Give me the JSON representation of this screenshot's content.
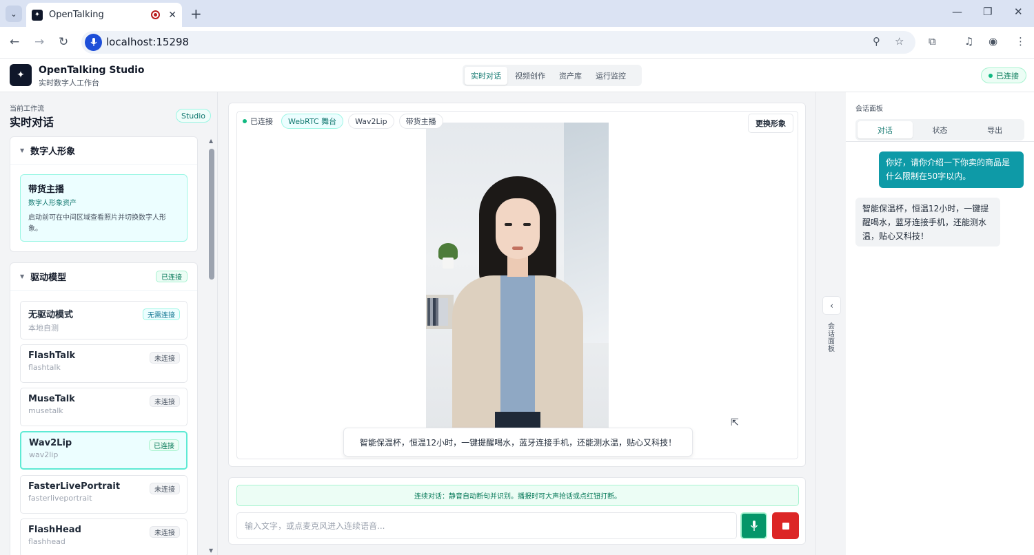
{
  "browser": {
    "tab_title": "OpenTalking",
    "url": "localhost:15298"
  },
  "header": {
    "app_title": "OpenTalking Studio",
    "app_subtitle": "实时数字人工作台",
    "nav": [
      "实时对话",
      "视频创作",
      "资产库",
      "运行监控"
    ],
    "connection_status": "已连接"
  },
  "sidebar": {
    "workflow_label": "当前工作流",
    "workflow_title": "实时对话",
    "studio_badge": "Studio",
    "avatar_section": {
      "title": "数字人形象",
      "item_name": "带货主播",
      "item_sub": "数字人形象资产",
      "item_desc": "启动前可在中间区域查看照片并切换数字人形象。"
    },
    "driver_section": {
      "title": "驱动模型",
      "status": "已连接",
      "models": [
        {
          "name": "无驱动模式",
          "id": "本地自测",
          "badge": "无需连接"
        },
        {
          "name": "FlashTalk",
          "id": "flashtalk",
          "badge": "未连接"
        },
        {
          "name": "MuseTalk",
          "id": "musetalk",
          "badge": "未连接"
        },
        {
          "name": "Wav2Lip",
          "id": "wav2lip",
          "badge": "已连接"
        },
        {
          "name": "FasterLivePortrait",
          "id": "fasterliveportrait",
          "badge": "未连接"
        },
        {
          "name": "FlashHead",
          "id": "flashhead",
          "badge": "未连接"
        }
      ]
    }
  },
  "stage": {
    "status": "已连接",
    "pills": [
      "WebRTC 舞台",
      "Wav2Lip",
      "带货主播"
    ],
    "change_button": "更换形象",
    "caption": "智能保温杯，恒温12小时，一键提醒喝水，蓝牙连接手机，还能测水温，贴心又科技！"
  },
  "input": {
    "hint": "连续对话：静音自动断句并识别。播报时可大声抢话或点红钮打断。",
    "placeholder": "输入文字，或点麦克风进入连续语音..."
  },
  "right_panel": {
    "rail_label": "会话面板",
    "title": "会话面板",
    "tabs": [
      "对话",
      "状态",
      "导出"
    ],
    "messages": [
      {
        "role": "user",
        "text": "你好，请你介绍一下你卖的商品是什么限制在50字以内。"
      },
      {
        "role": "assistant",
        "text": "智能保温杯，恒温12小时，一键提醒喝水，蓝牙连接手机，还能测水温，贴心又科技！"
      }
    ]
  },
  "colors": {
    "accent": "#0e9aa7",
    "success": "#059669",
    "danger": "#dc2626"
  }
}
